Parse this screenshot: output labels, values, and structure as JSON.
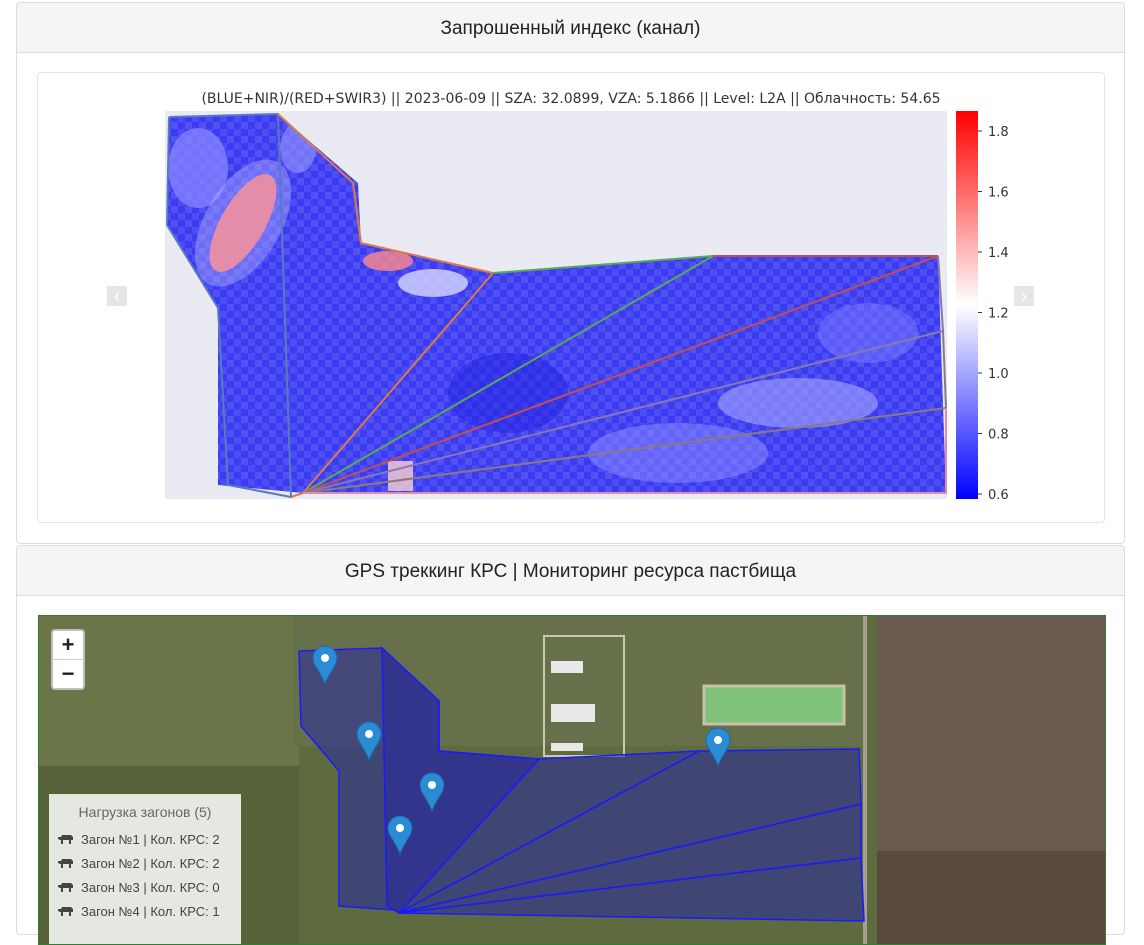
{
  "panel1": {
    "header": "Запрошенный индекс (канал)",
    "plot_title": "(BLUE+NIR)/(RED+SWIR3) || 2023-06-09 || SZA: 32.0899, VZA: 5.1866 || Level: L2A || Облачность: 54.65",
    "colorbar_ticks": [
      "1.8",
      "1.6",
      "1.4",
      "1.2",
      "1.0",
      "0.8",
      "0.6"
    ],
    "prev_icon": "chevron-left-icon",
    "next_icon": "chevron-right-icon",
    "colors": {
      "low": "#0000ff",
      "mid": "#ffffff",
      "high": "#ff0000",
      "background": "#eaeaf2"
    }
  },
  "panel2": {
    "header": "GPS треккинг КРС | Мониторинг ресурса пастбища",
    "zoom_in": "+",
    "zoom_out": "−",
    "legend": {
      "title": "Нагрузка загонов (5)",
      "items": [
        "Загон №1 | Кол. КРС: 2",
        "Загон №2 | Кол. КРС: 2",
        "Загон №3 | Кол. КРС: 0",
        "Загон №4 | Кол. КРС: 1"
      ]
    },
    "colors": {
      "paddock": "#1a1aff",
      "marker": "#2b8cd6"
    }
  }
}
